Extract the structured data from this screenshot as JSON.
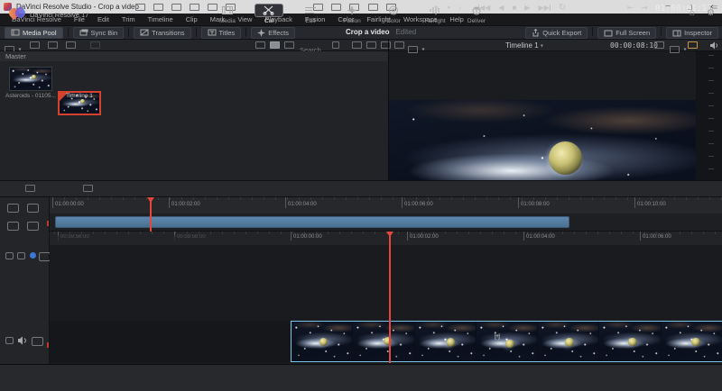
{
  "window": {
    "title": "DaVinci Resolve Studio - Crop a video",
    "controls": {
      "minimize": "─",
      "maximize": "▢",
      "close": "✕"
    }
  },
  "menu": {
    "items": [
      "DaVinci Resolve",
      "File",
      "Edit",
      "Trim",
      "Timeline",
      "Clip",
      "Mark",
      "View",
      "Playback",
      "Fusion",
      "Color",
      "Fairlight",
      "Workspace",
      "Help"
    ]
  },
  "toolbar": {
    "media_pool": "Media Pool",
    "sync_bin": "Sync Bin",
    "transitions": "Transitions",
    "titles": "Titles",
    "effects": "Effects",
    "project_title": "Crop a video",
    "project_status": "Edited",
    "quick_export": "Quick Export",
    "full_screen": "Full Screen",
    "inspector": "Inspector"
  },
  "media_pool": {
    "bin_name": "Master",
    "search_placeholder": "Search",
    "clips": [
      {
        "name": "Asteroids - 01105..."
      },
      {
        "name": "Timeline 1"
      }
    ]
  },
  "viewer": {
    "timeline_name": "Timeline 1",
    "duration_tc": "00:00:08:10"
  },
  "transport": {
    "current_tc": "01:00:01:17"
  },
  "timeline": {
    "upper_ruler": [
      "01:00:00:00",
      "01:00:02:00",
      "01:00:04:00",
      "01:00:06:00",
      "01:00:08:00",
      "01:00:10:00"
    ],
    "lower_ruler_pre": [
      "00:59:56:00",
      "00:59:58:00"
    ],
    "lower_ruler": [
      "01:00:00:00",
      "01:00:02:00",
      "01:00:04:00",
      "01:00:06:00"
    ],
    "insert_indicator": "[+]"
  },
  "bottom": {
    "app_label": "DaVinci Resolve 17",
    "tabs": [
      "Media",
      "Cut",
      "Edit",
      "Fusion",
      "Color",
      "Fairlight",
      "Deliver"
    ],
    "active_tab": "Cut"
  },
  "icons": {
    "chevron_down": "▾",
    "jog_left": "‹",
    "jog_dot": "●",
    "jog_right": "›",
    "skip_back": "◀◀",
    "reverse": "◀",
    "stop": "■",
    "play": "▶",
    "skip_fwd": "▶▶",
    "loop": "↻",
    "goto_in": "⇤",
    "goto_out": "⇥",
    "menu_burger": "≡",
    "home": "⌂",
    "gear": "⚙"
  },
  "colors": {
    "accent_red": "#e8453c",
    "overview_clip_blue": "#527aa1",
    "selection_blue": "#7cc4e8",
    "titlebar_bg": "#dcdcdc",
    "panel_bg": "#26282d"
  }
}
